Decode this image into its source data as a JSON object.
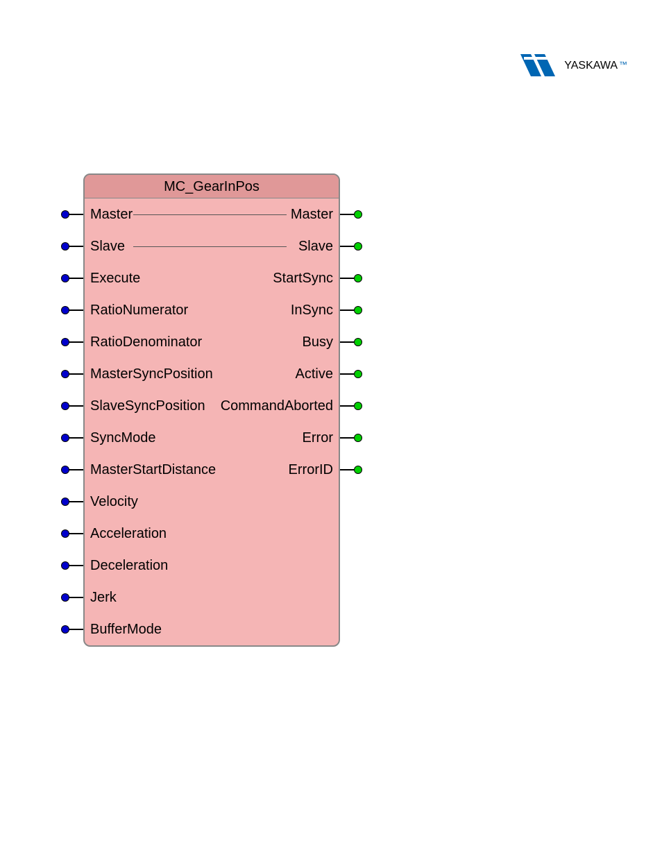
{
  "logo": {
    "text": "YASKAWA",
    "tm": "™"
  },
  "block": {
    "title": "MC_GearInPos",
    "inputs": [
      "Master",
      "Slave",
      "Execute",
      "RatioNumerator",
      "RatioDenominator",
      "MasterSyncPosition",
      "SlaveSyncPosition",
      "SyncMode",
      "MasterStartDistance",
      "Velocity",
      "Acceleration",
      "Deceleration",
      "Jerk",
      "BufferMode"
    ],
    "outputs": [
      "Master",
      "Slave",
      "StartSync",
      "InSync",
      "Busy",
      "Active",
      "CommandAborted",
      "Error",
      "ErrorID"
    ],
    "passthroughRows": [
      0,
      1
    ]
  }
}
